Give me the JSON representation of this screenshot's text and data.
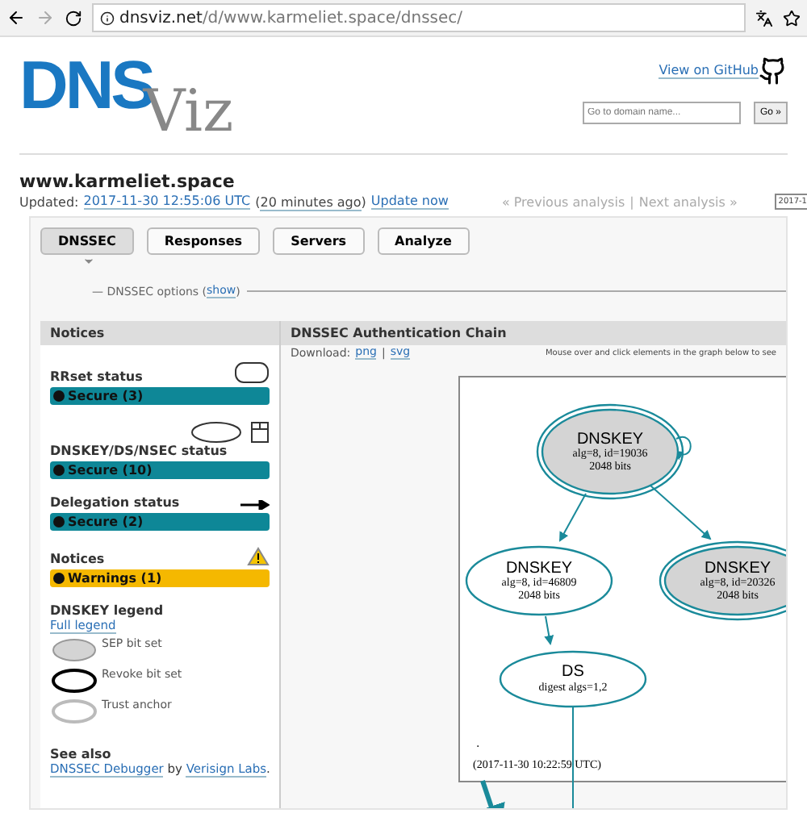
{
  "browser": {
    "url_host": "dnsviz.net",
    "url_path": "/d/www.karmeliet.space/dnssec/"
  },
  "header": {
    "logo_main": "DNS",
    "logo_sub": "Viz",
    "github_link": "View on GitHub",
    "search": {
      "placeholder": "Go to domain name..."
    },
    "go_button": "Go »"
  },
  "domain": {
    "name": "www.karmeliet.space",
    "updated_label": "Updated:",
    "updated_time": "2017-11-30 12:55:06 UTC",
    "ago_open": "(",
    "ago": "20 minutes ago",
    "ago_close": ")",
    "update_now": "Update now",
    "previous": "« Previous analysis",
    "separator": "|",
    "next": "Next analysis »",
    "date_select": "2017-1"
  },
  "tabs": [
    {
      "label": "DNSSEC",
      "selected": true
    },
    {
      "label": "Responses",
      "selected": false
    },
    {
      "label": "Servers",
      "selected": false
    },
    {
      "label": "Analyze",
      "selected": false
    }
  ],
  "options": {
    "label": "— DNSSEC options (",
    "link": "show",
    "close": ")"
  },
  "notices": {
    "title": "Notices",
    "sections": [
      {
        "heading": "RRset status",
        "kind": "rounded-rect",
        "status": "Secure (3)",
        "color": "#0e8797"
      },
      {
        "heading": "DNSKEY/DS/NSEC status",
        "kind": "ellipse-and-box",
        "status": "Secure (10)",
        "color": "#0e8797"
      },
      {
        "heading": "Delegation status",
        "kind": "arrow",
        "status": "Secure (2)",
        "color": "#0e8797"
      },
      {
        "heading": "Notices",
        "kind": "warning",
        "status": "Warnings (1)",
        "color": "#f5b800"
      }
    ],
    "legend_title": "DNSKEY legend",
    "full_legend": "Full legend",
    "legend": [
      {
        "label": "SEP bit set",
        "kind": "sep"
      },
      {
        "label": "Revoke bit set",
        "kind": "revoke"
      },
      {
        "label": "Trust anchor",
        "kind": "trust"
      }
    ],
    "see_also": "See also",
    "debugger_link": "DNSSEC Debugger",
    "by": "by",
    "verisign_link": "Verisign Labs",
    "period": "."
  },
  "chain": {
    "title": "DNSSEC Authentication Chain",
    "download_label": "Download:",
    "png": "png",
    "sep": "|",
    "svg": "svg",
    "hint": "Mouse over and click elements in the graph below to see",
    "nodes": [
      {
        "title": "DNSKEY",
        "line1": "alg=8, id=19036",
        "line2": "2048 bits",
        "sep": true
      },
      {
        "title": "DNSKEY",
        "line1": "alg=8, id=46809",
        "line2": "2048 bits",
        "sep": false
      },
      {
        "title": "DNSKEY",
        "line1": "alg=8, id=20326",
        "line2": "2048 bits",
        "sep": true
      },
      {
        "title": "DS",
        "line1": "digest algs=1,2",
        "sep": false
      }
    ],
    "zone_label": ".",
    "timestamp": "(2017-11-30 10:22:59 UTC)"
  }
}
